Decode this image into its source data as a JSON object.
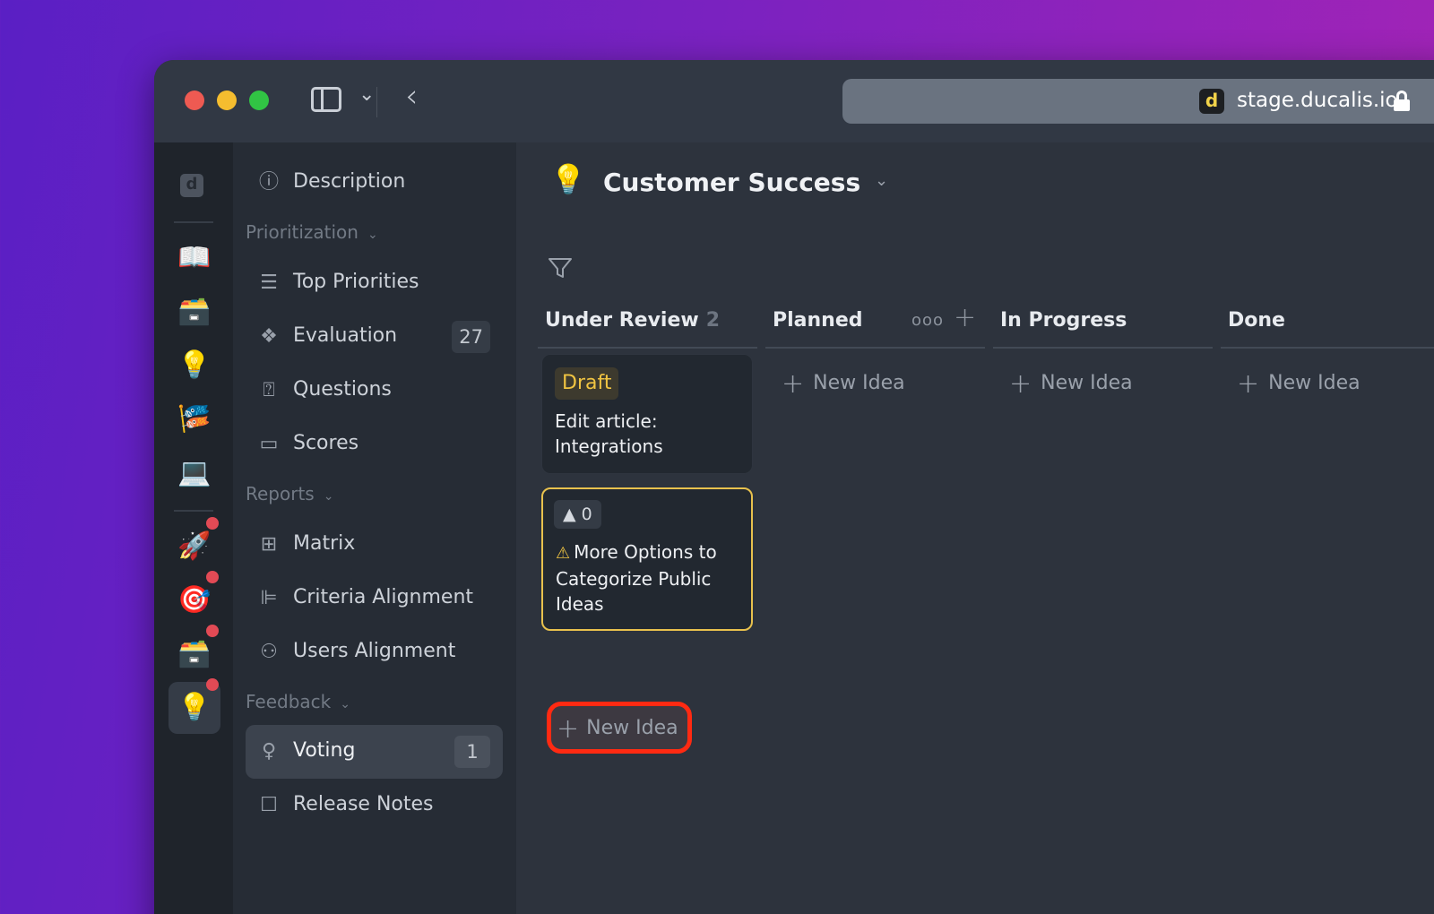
{
  "browser": {
    "url_logo_letter": "d",
    "url": "stage.ducalis.io"
  },
  "rail": {
    "logo_letter": "d",
    "items": [
      {
        "icon": "📖",
        "name": "open-book"
      },
      {
        "icon": "🗃️",
        "name": "card-file-box"
      },
      {
        "icon": "💡",
        "name": "light-bulb"
      },
      {
        "icon": "🎏",
        "name": "carp-streamer"
      },
      {
        "icon": "💻",
        "name": "laptop"
      },
      {
        "icon": "🚀",
        "name": "rocket"
      },
      {
        "icon": "🎯",
        "name": "target"
      },
      {
        "icon": "🗃️",
        "name": "card-file-box"
      },
      {
        "icon": "💡",
        "name": "light-bulb"
      }
    ]
  },
  "nav": {
    "description": "Description",
    "prioritization_section": "Prioritization",
    "top_priorities": "Top Priorities",
    "evaluation": "Evaluation",
    "evaluation_count": "27",
    "questions": "Questions",
    "scores": "Scores",
    "reports_section": "Reports",
    "matrix": "Matrix",
    "criteria_alignment": "Criteria Alignment",
    "users_alignment": "Users Alignment",
    "feedback_section": "Feedback",
    "voting": "Voting",
    "voting_count": "1",
    "release_notes": "Release Notes"
  },
  "board": {
    "icon": "💡",
    "title": "Customer Success"
  },
  "columns": [
    {
      "title": "Under Review",
      "count": "2"
    },
    {
      "title": "Planned",
      "more": "ooo",
      "new_idea": "New Idea"
    },
    {
      "title": "In Progress",
      "new_idea": "New Idea"
    },
    {
      "title": "Done",
      "new_idea": "New Idea"
    }
  ],
  "cards": {
    "card1": {
      "status": "Draft",
      "title": "Edit article: Integrations"
    },
    "card2": {
      "votes": "0",
      "title": "More Options to Categorize Public Ideas"
    }
  },
  "under_review_new_idea": "New Idea",
  "colors": {
    "accent_yellow": "#f0c442",
    "highlight_red": "#ff2a12"
  }
}
